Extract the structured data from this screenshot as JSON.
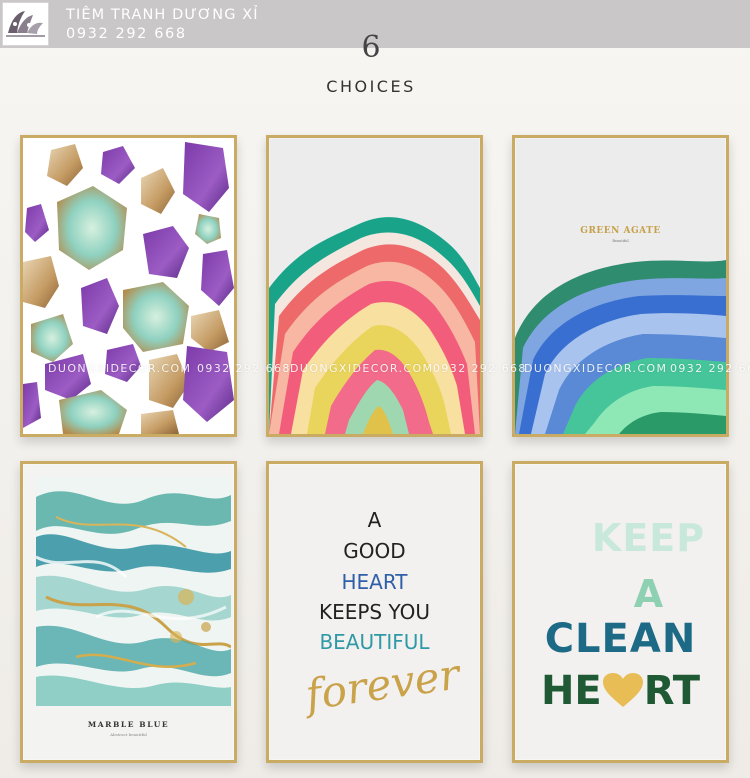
{
  "banner": {
    "shop_name": "TIÊM TRANH DƯƠNG XỈ",
    "phone": "0932 292 668",
    "logo_text": "",
    "colors": {
      "banner_bg": "#c9c7c8",
      "text": "#ffffff"
    }
  },
  "heading": {
    "count": "6",
    "label": "CHOICES"
  },
  "watermark": {
    "site": "DUONGXIDECOR.COM",
    "phone": "0932 292 668"
  },
  "posters": {
    "crystals": {
      "subject": "amethyst and turquoise crystals"
    },
    "agate_rainbow": {
      "subject": "rainbow agate slice"
    },
    "green_agate": {
      "title": "GREEN AGATE",
      "subtitle": "Beautiful"
    },
    "marble_blue": {
      "title": "MARBLE BLUE",
      "subtitle": "Abstract beautiful"
    },
    "quote": {
      "line1": "A",
      "line2": "GOOD",
      "line3": "HEART",
      "line4": "KEEPS YOU",
      "line5": "BEAUTIFUL",
      "script": "forever"
    },
    "keep_clean": {
      "line1": "KEEP",
      "line2": "A",
      "line3": "CLEAN",
      "line4_left": "HE",
      "line4_right": "RT",
      "colors": {
        "keep": "#c9e8dc",
        "a": "#8ed0b2",
        "clean": "#1d6a86",
        "heart_word": "#1f5a34",
        "heart_icon": "#e9bd55"
      }
    }
  },
  "colors": {
    "frame": "#c9ab63",
    "wall": "#f3f1ee"
  }
}
